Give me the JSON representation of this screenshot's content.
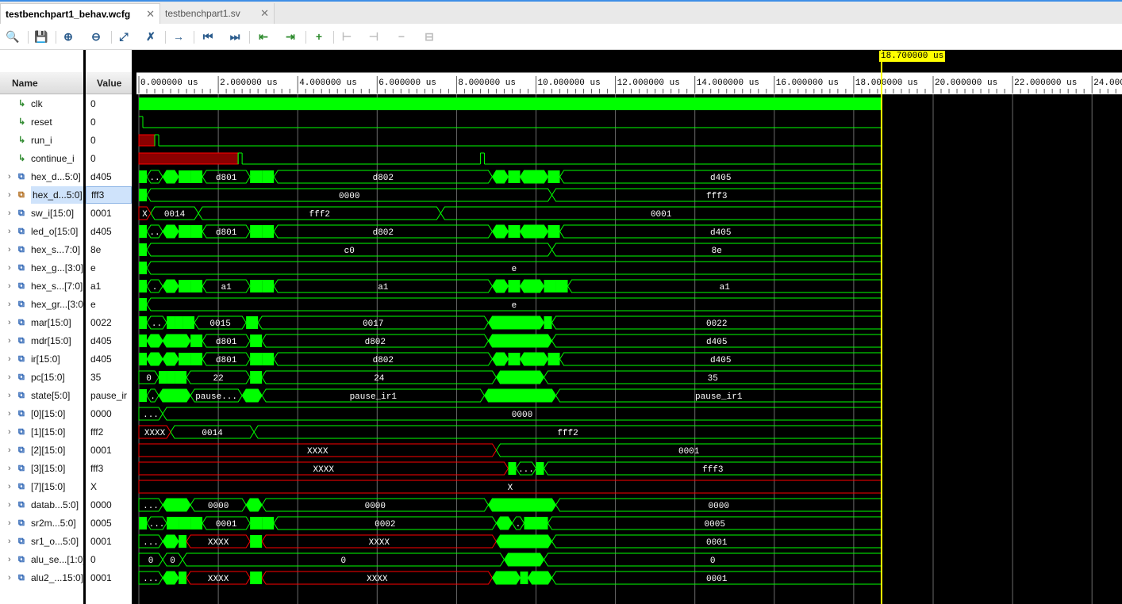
{
  "tabs": [
    {
      "label": "testbenchpart1_behav.wcfg",
      "active": true
    },
    {
      "label": "testbenchpart1.sv",
      "active": false
    }
  ],
  "toolbar": [
    {
      "icon": "search-icon",
      "glyph": "🔍",
      "tone": "blue"
    },
    {
      "icon": "save-icon",
      "glyph": "💾",
      "tone": "blue"
    },
    {
      "icon": "zoom-in-icon",
      "glyph": "⊕",
      "tone": "blue"
    },
    {
      "icon": "zoom-out-icon",
      "glyph": "⊖",
      "tone": "blue"
    },
    {
      "icon": "zoom-fit-icon",
      "glyph": "⤢",
      "tone": "blue"
    },
    {
      "icon": "zoom-to-cursor-icon",
      "glyph": "✗",
      "tone": "blue"
    },
    {
      "icon": "go-to-cursor-icon",
      "glyph": "→",
      "tone": "blue"
    },
    {
      "icon": "go-to-time-zero-icon",
      "glyph": "⏮",
      "tone": "blue"
    },
    {
      "icon": "go-to-last-time-icon",
      "glyph": "⏭",
      "tone": "blue"
    },
    {
      "icon": "previous-transition-icon",
      "glyph": "⇤",
      "tone": "green"
    },
    {
      "icon": "next-transition-icon",
      "glyph": "⇥",
      "tone": "green"
    },
    {
      "icon": "add-marker-icon",
      "glyph": "+",
      "tone": "green"
    },
    {
      "icon": "previous-marker-icon",
      "glyph": "⊢",
      "tone": "gray"
    },
    {
      "icon": "next-marker-icon",
      "glyph": "⊣",
      "tone": "gray"
    },
    {
      "icon": "delete-marker-icon",
      "glyph": "−",
      "tone": "gray"
    },
    {
      "icon": "swap-cursors-icon",
      "glyph": "⊟",
      "tone": "gray"
    }
  ],
  "columns": {
    "name": "Name",
    "value": "Value"
  },
  "cursor": {
    "time_label": "18.700000 us",
    "time_us": 18.7
  },
  "timeline": {
    "ticks": [
      "0.000000 us",
      "2.000000 us",
      "4.000000 us",
      "6.000000 us",
      "8.000000 us",
      "10.000000 us",
      "12.000000 us",
      "14.000000 us",
      "16.000000 us",
      "18.000000 us",
      "20.000000 us",
      "22.000000 us",
      "24.000000 us"
    ]
  },
  "colors": {
    "wave": "#00ff00",
    "x_state": "#ff0000",
    "cursor": "#ffff00"
  },
  "signals": [
    {
      "name": "clk",
      "value": "0",
      "kind": "bit",
      "wave": {
        "type": "clock"
      }
    },
    {
      "name": "reset",
      "value": "0",
      "kind": "bit",
      "wave": {
        "type": "bit",
        "init": 1,
        "edges": [
          0.1
        ]
      }
    },
    {
      "name": "run_i",
      "value": "0",
      "kind": "bit",
      "wave": {
        "type": "bit",
        "init": "x",
        "edges": [
          0.4,
          0.5
        ]
      }
    },
    {
      "name": "continue_i",
      "value": "0",
      "kind": "bit",
      "wave": {
        "type": "bit",
        "init": "x",
        "edges": [
          2.5,
          2.6,
          8.6,
          8.7
        ]
      }
    },
    {
      "name": "hex_d...5:0]",
      "value": "d405",
      "kind": "bus",
      "expand": true,
      "wave": {
        "type": "bus",
        "segs": [
          {
            "s": 0,
            "v": ""
          },
          {
            "s": 0.2,
            "v": ".."
          },
          {
            "s": 0.6,
            "v": ""
          },
          {
            "s": 1,
            "v": ""
          },
          {
            "s": 1.3,
            "v": ""
          },
          {
            "s": 1.6,
            "v": "d801"
          },
          {
            "s": 2.8,
            "v": ""
          },
          {
            "s": 3.1,
            "v": ""
          },
          {
            "s": 3.4,
            "v": "d802"
          },
          {
            "s": 8.9,
            "v": ""
          },
          {
            "s": 9.3,
            "v": ""
          },
          {
            "s": 9.6,
            "v": ""
          },
          {
            "s": 10.3,
            "v": ""
          },
          {
            "s": 10.6,
            "v": "d405"
          }
        ]
      }
    },
    {
      "name": "hex_d...5:0]",
      "value": "fff3",
      "kind": "sel",
      "expand": true,
      "selected": true,
      "wave": {
        "type": "bus",
        "segs": [
          {
            "s": 0,
            "v": ""
          },
          {
            "s": 0.2,
            "v": "0000"
          },
          {
            "s": 10.4,
            "v": "fff3"
          }
        ]
      }
    },
    {
      "name": "sw_i[15:0]",
      "value": "0001",
      "kind": "bus",
      "expand": true,
      "wave": {
        "type": "bus",
        "segs": [
          {
            "s": 0,
            "v": "X"
          },
          {
            "s": 0.3,
            "v": "0014"
          },
          {
            "s": 1.5,
            "v": "fff2"
          },
          {
            "s": 7.6,
            "v": "0001"
          }
        ]
      }
    },
    {
      "name": "led_o[15:0]",
      "value": "d405",
      "kind": "bus",
      "expand": true,
      "wave": {
        "type": "bus",
        "segs": [
          {
            "s": 0,
            "v": ""
          },
          {
            "s": 0.2,
            "v": ".."
          },
          {
            "s": 0.6,
            "v": ""
          },
          {
            "s": 1,
            "v": ""
          },
          {
            "s": 1.3,
            "v": ""
          },
          {
            "s": 1.6,
            "v": "d801"
          },
          {
            "s": 2.8,
            "v": ""
          },
          {
            "s": 3.1,
            "v": ""
          },
          {
            "s": 3.4,
            "v": "d802"
          },
          {
            "s": 8.9,
            "v": ""
          },
          {
            "s": 9.3,
            "v": ""
          },
          {
            "s": 9.6,
            "v": ""
          },
          {
            "s": 10.3,
            "v": ""
          },
          {
            "s": 10.6,
            "v": "d405"
          }
        ]
      }
    },
    {
      "name": "hex_s...7:0]",
      "value": "8e",
      "kind": "bus",
      "expand": true,
      "wave": {
        "type": "bus",
        "segs": [
          {
            "s": 0,
            "v": ""
          },
          {
            "s": 0.2,
            "v": "c0"
          },
          {
            "s": 10.4,
            "v": "8e"
          }
        ]
      }
    },
    {
      "name": "hex_g...[3:0]",
      "value": "e",
      "kind": "bus",
      "expand": true,
      "wave": {
        "type": "bus",
        "segs": [
          {
            "s": 0,
            "v": ""
          },
          {
            "s": 0.2,
            "v": "e"
          }
        ]
      }
    },
    {
      "name": "hex_s...[7:0]",
      "value": "a1",
      "kind": "bus",
      "expand": true,
      "wave": {
        "type": "bus",
        "segs": [
          {
            "s": 0,
            "v": ""
          },
          {
            "s": 0.2,
            "v": "."
          },
          {
            "s": 0.6,
            "v": ""
          },
          {
            "s": 1,
            "v": ""
          },
          {
            "s": 1.3,
            "v": ""
          },
          {
            "s": 1.6,
            "v": "a1"
          },
          {
            "s": 2.8,
            "v": ""
          },
          {
            "s": 3.1,
            "v": ""
          },
          {
            "s": 3.4,
            "v": "a1"
          },
          {
            "s": 8.9,
            "v": ""
          },
          {
            "s": 9.3,
            "v": ""
          },
          {
            "s": 9.6,
            "v": ""
          },
          {
            "s": 10.2,
            "v": ""
          },
          {
            "s": 10.5,
            "v": ""
          },
          {
            "s": 10.8,
            "v": "a1"
          }
        ]
      }
    },
    {
      "name": "hex_gr...[3:0]",
      "value": "e",
      "kind": "bus",
      "expand": true,
      "wave": {
        "type": "bus",
        "segs": [
          {
            "s": 0,
            "v": ""
          },
          {
            "s": 0.2,
            "v": "e"
          }
        ]
      }
    },
    {
      "name": "mar[15:0]",
      "value": "0022",
      "kind": "bus",
      "expand": true,
      "wave": {
        "type": "bus",
        "segs": [
          {
            "s": 0,
            "v": ""
          },
          {
            "s": 0.2,
            "v": ".."
          },
          {
            "s": 0.7,
            "v": ""
          },
          {
            "s": 0.9,
            "v": ""
          },
          {
            "s": 1.1,
            "v": ""
          },
          {
            "s": 1.4,
            "v": "0015"
          },
          {
            "s": 2.7,
            "v": ""
          },
          {
            "s": 3,
            "v": "0017"
          },
          {
            "s": 8.8,
            "v": ""
          },
          {
            "s": 10.2,
            "v": ""
          },
          {
            "s": 10.4,
            "v": "0022"
          }
        ]
      }
    },
    {
      "name": "mdr[15:0]",
      "value": "d405",
      "kind": "bus",
      "expand": true,
      "wave": {
        "type": "bus",
        "segs": [
          {
            "s": 0,
            "v": ""
          },
          {
            "s": 0.2,
            "v": ""
          },
          {
            "s": 0.6,
            "v": ""
          },
          {
            "s": 1.3,
            "v": ""
          },
          {
            "s": 1.6,
            "v": "d801"
          },
          {
            "s": 2.8,
            "v": ""
          },
          {
            "s": 3.1,
            "v": "d802"
          },
          {
            "s": 8.8,
            "v": ""
          },
          {
            "s": 10.4,
            "v": "d405"
          }
        ]
      }
    },
    {
      "name": "ir[15:0]",
      "value": "d405",
      "kind": "bus",
      "expand": true,
      "wave": {
        "type": "bus",
        "segs": [
          {
            "s": 0,
            "v": ""
          },
          {
            "s": 0.2,
            "v": ""
          },
          {
            "s": 0.6,
            "v": ""
          },
          {
            "s": 1,
            "v": ""
          },
          {
            "s": 1.3,
            "v": ""
          },
          {
            "s": 1.6,
            "v": "d801"
          },
          {
            "s": 2.8,
            "v": ""
          },
          {
            "s": 3.1,
            "v": ""
          },
          {
            "s": 3.4,
            "v": "d802"
          },
          {
            "s": 8.9,
            "v": ""
          },
          {
            "s": 9.3,
            "v": ""
          },
          {
            "s": 9.6,
            "v": ""
          },
          {
            "s": 10.3,
            "v": ""
          },
          {
            "s": 10.6,
            "v": "d405"
          }
        ]
      }
    },
    {
      "name": "pc[15:0]",
      "value": "35",
      "kind": "bus",
      "expand": true,
      "wave": {
        "type": "bus",
        "segs": [
          {
            "s": 0,
            "v": "0"
          },
          {
            "s": 0.5,
            "v": ""
          },
          {
            "s": 0.7,
            "v": ""
          },
          {
            "s": 0.9,
            "v": ""
          },
          {
            "s": 1.2,
            "v": "22"
          },
          {
            "s": 2.8,
            "v": ""
          },
          {
            "s": 3.1,
            "v": "24"
          },
          {
            "s": 9,
            "v": ""
          },
          {
            "s": 10.2,
            "v": "35"
          }
        ]
      }
    },
    {
      "name": "state[5:0]",
      "value": "pause_ir",
      "kind": "bus",
      "expand": true,
      "wave": {
        "type": "bus",
        "segs": [
          {
            "s": 0,
            "v": ""
          },
          {
            "s": 0.2,
            "v": "."
          },
          {
            "s": 0.5,
            "v": ""
          },
          {
            "s": 1.3,
            "v": "pause..."
          },
          {
            "s": 2.6,
            "v": ""
          },
          {
            "s": 3.1,
            "v": "pause_ir1"
          },
          {
            "s": 8.7,
            "v": ""
          },
          {
            "s": 10.5,
            "v": "pause_ir1"
          }
        ]
      }
    },
    {
      "name": "[0][15:0]",
      "value": "0000",
      "kind": "bus",
      "expand": true,
      "wave": {
        "type": "bus",
        "segs": [
          {
            "s": 0,
            "v": "..."
          },
          {
            "s": 0.6,
            "v": "0000"
          }
        ]
      }
    },
    {
      "name": "[1][15:0]",
      "value": "fff2",
      "kind": "bus",
      "expand": true,
      "wave": {
        "type": "bus",
        "segs": [
          {
            "s": 0,
            "v": "XXXX"
          },
          {
            "s": 0.8,
            "v": "0014"
          },
          {
            "s": 2.9,
            "v": "fff2"
          }
        ]
      }
    },
    {
      "name": "[2][15:0]",
      "value": "0001",
      "kind": "bus",
      "expand": true,
      "wave": {
        "type": "bus",
        "segs": [
          {
            "s": 0,
            "v": "XXXX"
          },
          {
            "s": 9,
            "v": "0001"
          }
        ]
      }
    },
    {
      "name": "[3][15:0]",
      "value": "fff3",
      "kind": "bus",
      "expand": true,
      "wave": {
        "type": "bus",
        "segs": [
          {
            "s": 0,
            "v": "XXXX"
          },
          {
            "s": 9.3,
            "v": ""
          },
          {
            "s": 9.5,
            "v": "..."
          },
          {
            "s": 10,
            "v": ""
          },
          {
            "s": 10.2,
            "v": "fff3"
          }
        ]
      }
    },
    {
      "name": "[7][15:0]",
      "value": "X",
      "kind": "bus",
      "expand": true,
      "wave": {
        "type": "bus",
        "segs": [
          {
            "s": 0,
            "v": "X"
          }
        ]
      }
    },
    {
      "name": "datab...5:0]",
      "value": "0000",
      "kind": "bus",
      "expand": true,
      "wave": {
        "type": "bus",
        "segs": [
          {
            "s": 0,
            "v": "..."
          },
          {
            "s": 0.6,
            "v": ""
          },
          {
            "s": 1.3,
            "v": "0000"
          },
          {
            "s": 2.7,
            "v": ""
          },
          {
            "s": 3.1,
            "v": "0000"
          },
          {
            "s": 8.8,
            "v": ""
          },
          {
            "s": 10.5,
            "v": "0000"
          }
        ]
      }
    },
    {
      "name": "sr2m...5:0]",
      "value": "0005",
      "kind": "bus",
      "expand": true,
      "wave": {
        "type": "bus",
        "segs": [
          {
            "s": 0,
            "v": ""
          },
          {
            "s": 0.2,
            "v": "..."
          },
          {
            "s": 0.7,
            "v": ""
          },
          {
            "s": 1,
            "v": ""
          },
          {
            "s": 1.3,
            "v": ""
          },
          {
            "s": 1.6,
            "v": "0001"
          },
          {
            "s": 2.8,
            "v": ""
          },
          {
            "s": 3.1,
            "v": ""
          },
          {
            "s": 3.4,
            "v": "0002"
          },
          {
            "s": 9,
            "v": ""
          },
          {
            "s": 9.4,
            "v": "."
          },
          {
            "s": 9.7,
            "v": ""
          },
          {
            "s": 10,
            "v": ""
          },
          {
            "s": 10.3,
            "v": "0005"
          }
        ]
      }
    },
    {
      "name": "sr1_o...5:0]",
      "value": "0001",
      "kind": "bus",
      "expand": true,
      "wave": {
        "type": "bus",
        "segs": [
          {
            "s": 0,
            "v": "..."
          },
          {
            "s": 0.6,
            "v": ""
          },
          {
            "s": 1,
            "v": ""
          },
          {
            "s": 1.2,
            "v": "XXXX"
          },
          {
            "s": 2.8,
            "v": ""
          },
          {
            "s": 3.1,
            "v": "XXXX"
          },
          {
            "s": 9,
            "v": ""
          },
          {
            "s": 10.4,
            "v": "0001"
          }
        ]
      }
    },
    {
      "name": "alu_se...[1:0]",
      "value": "0",
      "kind": "bus",
      "expand": true,
      "wave": {
        "type": "bus",
        "segs": [
          {
            "s": 0,
            "v": "0"
          },
          {
            "s": 0.6,
            "v": "0"
          },
          {
            "s": 1.1,
            "v": "0"
          },
          {
            "s": 9.2,
            "v": ""
          },
          {
            "s": 10.2,
            "v": "0"
          }
        ]
      }
    },
    {
      "name": "alu2_...15:0]",
      "value": "0001",
      "kind": "bus",
      "expand": true,
      "wave": {
        "type": "bus",
        "segs": [
          {
            "s": 0,
            "v": "..."
          },
          {
            "s": 0.6,
            "v": ""
          },
          {
            "s": 1,
            "v": ""
          },
          {
            "s": 1.2,
            "v": "XXXX"
          },
          {
            "s": 2.8,
            "v": ""
          },
          {
            "s": 3.1,
            "v": "XXXX"
          },
          {
            "s": 8.9,
            "v": ""
          },
          {
            "s": 9.6,
            "v": ""
          },
          {
            "s": 9.8,
            "v": ""
          },
          {
            "s": 10.4,
            "v": "0001"
          }
        ]
      }
    }
  ]
}
